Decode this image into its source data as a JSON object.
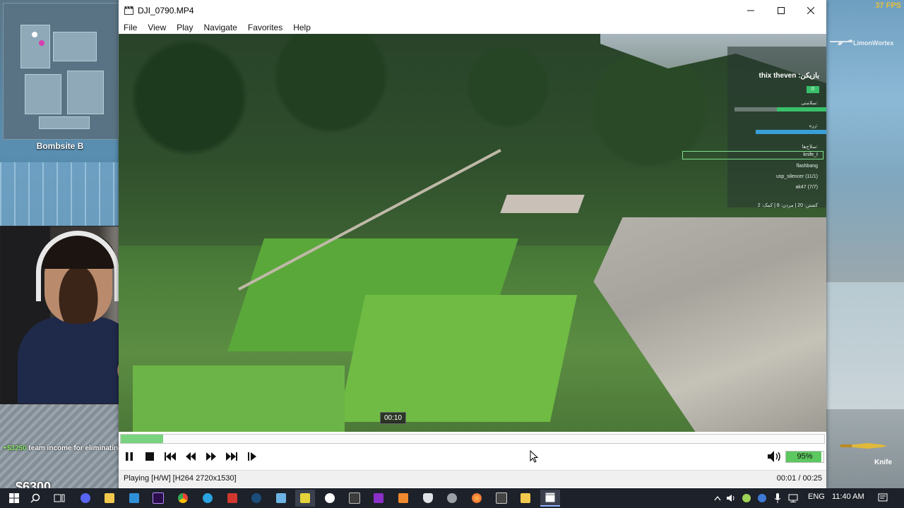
{
  "game": {
    "fps": "37 FPS",
    "bombsite": "Bombsite B",
    "weapon_name": "LimonWortex",
    "knife_label": "Knife",
    "income_amount": "+$3250",
    "income_text": " team income for eliminating",
    "money": "$6300"
  },
  "player": {
    "title": "DJI_0790.MP4",
    "menu": [
      "File",
      "View",
      "Play",
      "Navigate",
      "Favorites",
      "Help"
    ],
    "overlay": {
      "player_title": "thix theven :بازیکن",
      "badge": "0",
      "health_label": "سلامتی:",
      "armor_label": "زره:",
      "weapons_label": "سلاح‌ها:",
      "weapons": [
        "knife_t",
        "flashbang",
        "usp_silencer (11/1)",
        "ak47 (7/7)"
      ],
      "stats": "کشتن: 20 | مردن: 8 | کمک: 2"
    },
    "timestamp_tooltip": "00:10",
    "seek_progress": 0.06,
    "volume_percent": 0.95,
    "volume_label": "95%",
    "status_left": "Playing [H/W]   [H264 2720x1530]",
    "status_right": "00:01 / 00:25"
  },
  "taskbar": {
    "lang": "ENG",
    "time": "11:40 AM"
  },
  "colors": {
    "accent": "#79d37e",
    "volume": "#5cc85f",
    "taskbar": "#1d2129"
  }
}
